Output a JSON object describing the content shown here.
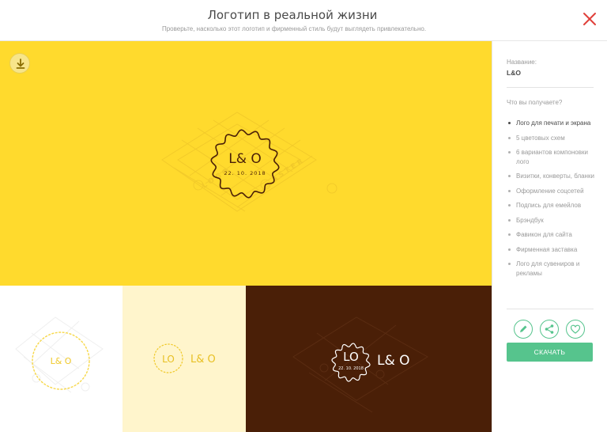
{
  "header": {
    "title": "Логотип в реальной жизни",
    "subtitle": "Проверьте, насколько этот логотип и фирменный стиль будут выглядеть привлекательно."
  },
  "preview": {
    "panel_colors": {
      "yellow": "#ffda2d",
      "white": "#ffffff",
      "cream": "#fff5cc",
      "brown": "#4a1f07"
    },
    "logo": {
      "name": "L& O",
      "date": "22. 10. 2018",
      "name_compact": "L& O",
      "monogram": "LO",
      "monogram_small": "LO"
    },
    "download_icon": "download-icon"
  },
  "sidebar": {
    "name_label": "Название:",
    "name_value": "L&O",
    "features_title": "Что вы получаете?",
    "features": [
      {
        "label": "Лого для печати и экрана",
        "active": true
      },
      {
        "label": "5 цветовых схем",
        "active": false
      },
      {
        "label": "6 вариантов компоновки лого",
        "active": false
      },
      {
        "label": "Визитки, конверты, бланки",
        "active": false
      },
      {
        "label": "Оформление соцсетей",
        "active": false
      },
      {
        "label": "Подпись для емейлов",
        "active": false
      },
      {
        "label": "Брэндбук",
        "active": false
      },
      {
        "label": "Фавикон для сайта",
        "active": false
      },
      {
        "label": "Фирменная заставка",
        "active": false
      },
      {
        "label": "Лого для сувениров и рекламы",
        "active": false
      }
    ],
    "actions": [
      "edit-icon",
      "share-icon",
      "heart-icon"
    ],
    "buy_label": "СКАЧАТЬ",
    "accent_color": "#56c48d"
  }
}
